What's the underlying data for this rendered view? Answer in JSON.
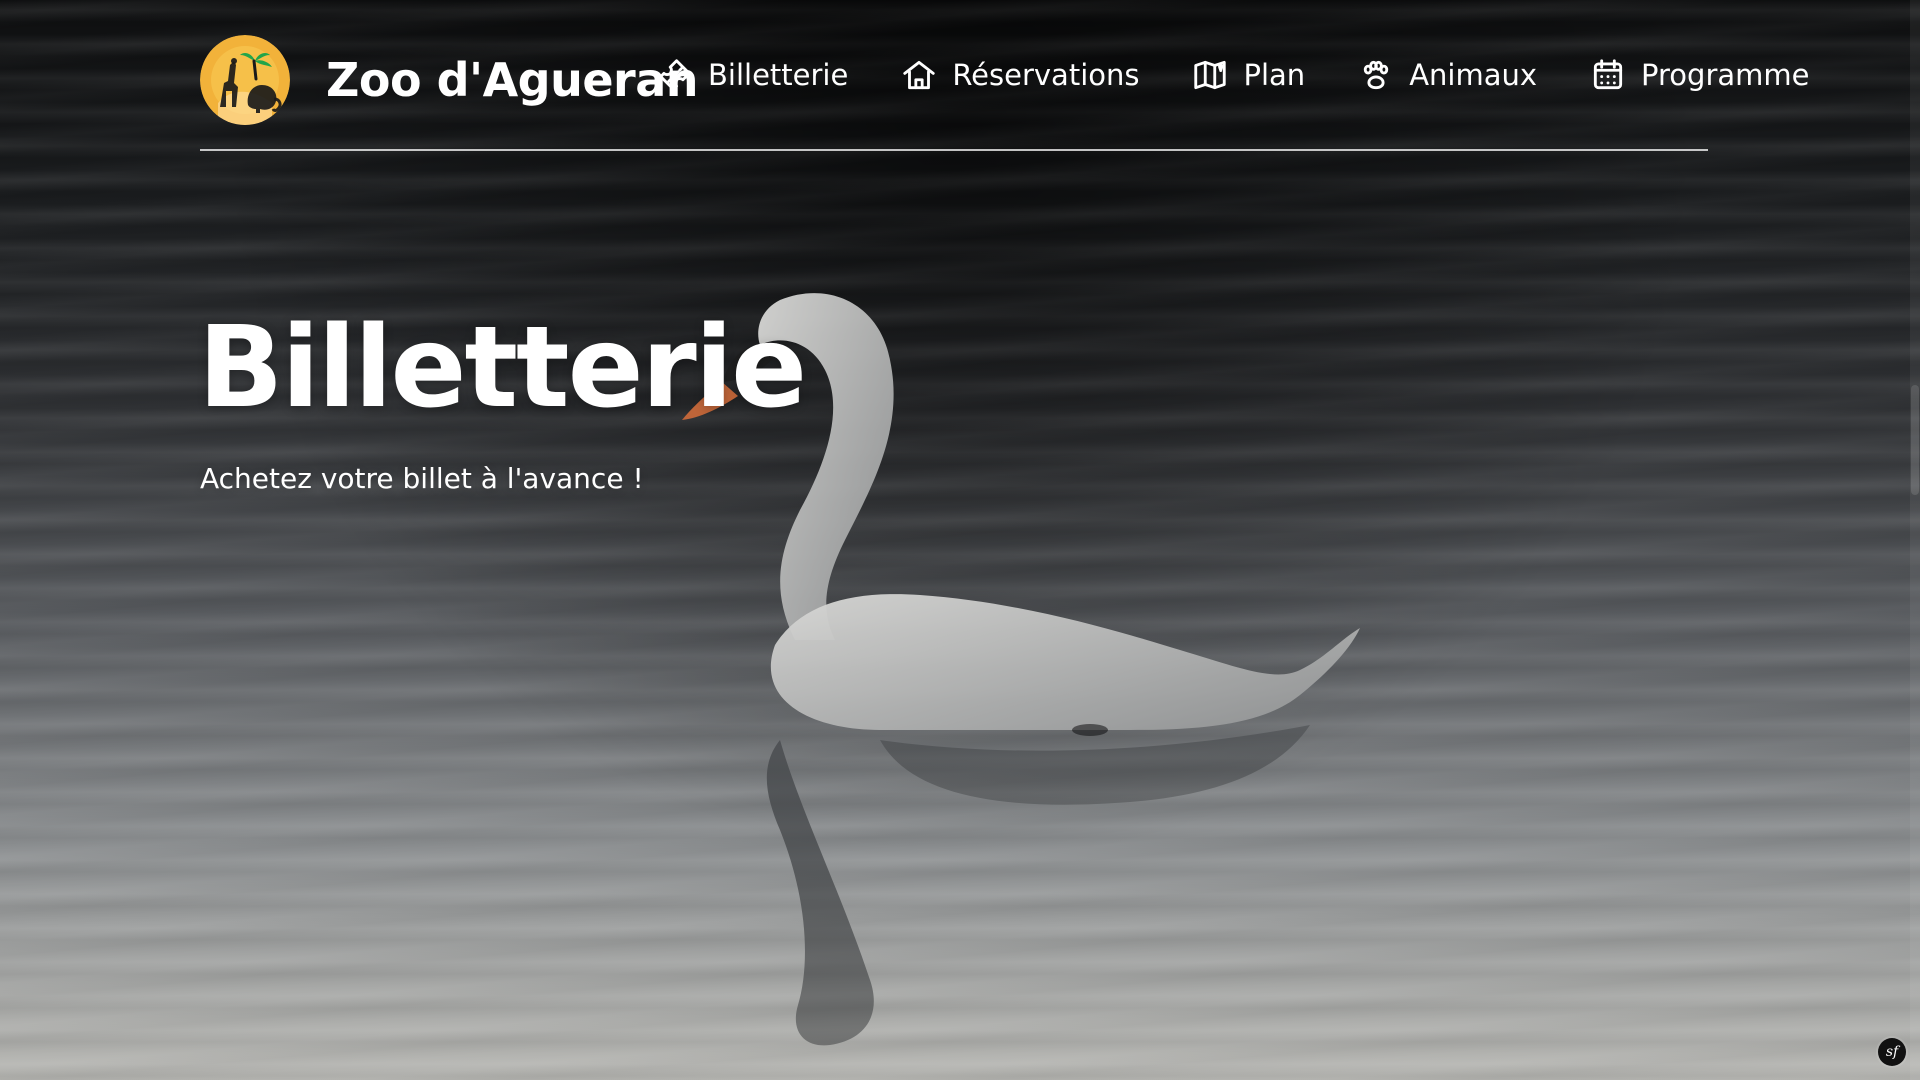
{
  "header": {
    "brand_name": "Zoo d'Agueran",
    "nav": [
      {
        "label": "Billetterie",
        "icon": "ticket-icon"
      },
      {
        "label": "Réservations",
        "icon": "home-icon"
      },
      {
        "label": "Plan",
        "icon": "map-icon"
      },
      {
        "label": "Animaux",
        "icon": "paw-icon"
      },
      {
        "label": "Programme",
        "icon": "calendar-icon"
      }
    ]
  },
  "hero": {
    "title": "Billetterie",
    "subtitle": "Achetez votre billet à l'avance !"
  },
  "badges": {
    "symfony": "sf"
  },
  "colors": {
    "text": "#ffffff",
    "logo_gold": "#f2b23a",
    "logo_dark": "#1a1a1a",
    "logo_green": "#23a54a"
  }
}
